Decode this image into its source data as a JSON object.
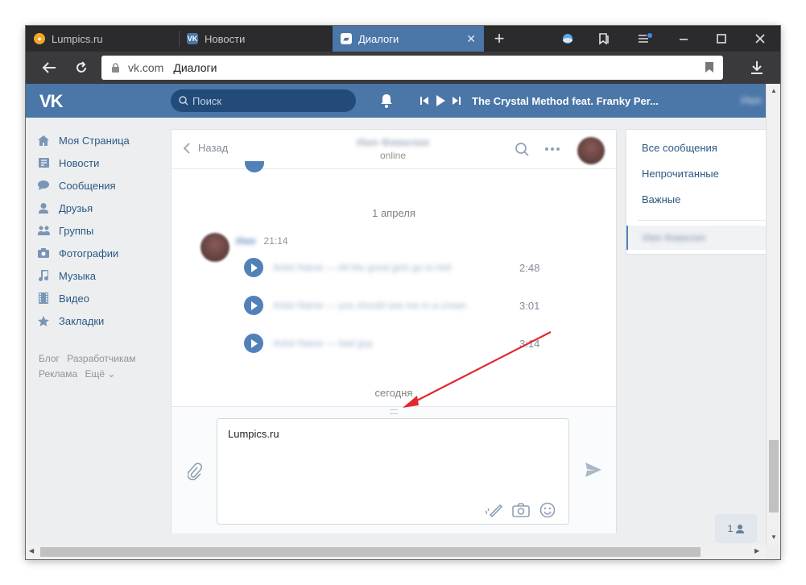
{
  "tabs": [
    {
      "label": "Lumpics.ru",
      "icon": "lumpics-favicon"
    },
    {
      "label": "Новости",
      "icon": "vk-favicon"
    },
    {
      "label": "Диалоги",
      "icon": "dialogs-favicon",
      "active": true
    }
  ],
  "address": {
    "domain": "vk.com",
    "title": "Диалоги"
  },
  "vk_header": {
    "logo": "VK",
    "search_placeholder": "Поиск",
    "now_playing": "The Crystal Method feat. Franky Per...",
    "username_blur": "Имя"
  },
  "left_nav": [
    {
      "label": "Моя Страница",
      "icon": "home-icon"
    },
    {
      "label": "Новости",
      "icon": "news-icon"
    },
    {
      "label": "Сообщения",
      "icon": "messages-icon"
    },
    {
      "label": "Друзья",
      "icon": "friends-icon"
    },
    {
      "label": "Группы",
      "icon": "groups-icon"
    },
    {
      "label": "Фотографии",
      "icon": "photos-icon"
    },
    {
      "label": "Музыка",
      "icon": "music-icon"
    },
    {
      "label": "Видео",
      "icon": "video-icon"
    },
    {
      "label": "Закладки",
      "icon": "bookmarks-icon"
    }
  ],
  "footer_links": {
    "blog": "Блог",
    "developers": "Разработчикам",
    "ads": "Реклама",
    "more": "Ещё ⌄"
  },
  "chat": {
    "back_label": "Назад",
    "contact_name_blur": "Имя Фамилия",
    "status": "online",
    "date_separator": "1 апреля",
    "sender_blur": "Имя",
    "message_time": "21:14",
    "tracks": [
      {
        "title_blur": "Artist Name — All the good girls go to hell",
        "duration": "2:48"
      },
      {
        "title_blur": "Artist Name — you should see me in a crown",
        "duration": "3:01"
      },
      {
        "title_blur": "Artist Name — bad guy",
        "duration": "3:14"
      }
    ],
    "today_separator": "сегодня",
    "input_value": "Lumpics.ru"
  },
  "right_panel": {
    "items": [
      "Все сообщения",
      "Непрочитанные",
      "Важные"
    ],
    "selected_blur": "Имя Фамилия"
  },
  "online_count": "1",
  "colors": {
    "vk_blue": "#4a76a8",
    "link": "#2a5885",
    "annotation_arrow": "#e0282e"
  }
}
